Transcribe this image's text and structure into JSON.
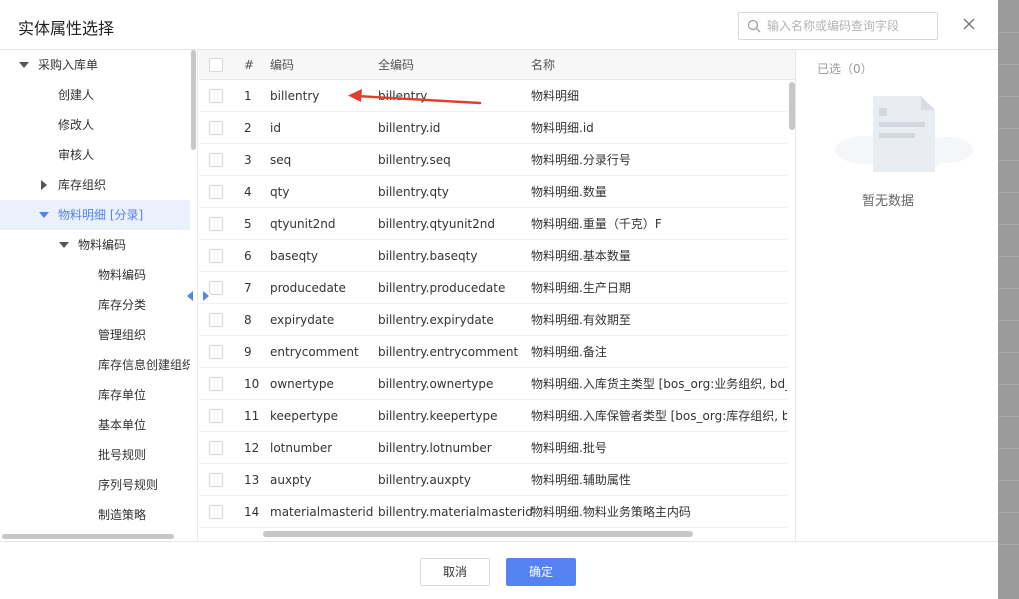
{
  "dialog": {
    "title": "实体属性选择",
    "search_placeholder": "输入名称或编码查询字段"
  },
  "tree": {
    "items": [
      {
        "label": "采购入库单",
        "level": 0,
        "caret": "down",
        "selected": false
      },
      {
        "label": "创建人",
        "level": 1,
        "caret": "none",
        "selected": false
      },
      {
        "label": "修改人",
        "level": 1,
        "caret": "none",
        "selected": false
      },
      {
        "label": "审核人",
        "level": 1,
        "caret": "none",
        "selected": false
      },
      {
        "label": "库存组织",
        "level": 1,
        "caret": "right",
        "selected": false
      },
      {
        "label": "物料明细 [分录]",
        "level": 1,
        "caret": "down",
        "selected": true
      },
      {
        "label": "物料编码",
        "level": 2,
        "caret": "down",
        "selected": false
      },
      {
        "label": "物料编码",
        "level": 3,
        "caret": "none",
        "selected": false
      },
      {
        "label": "库存分类",
        "level": 3,
        "caret": "none",
        "selected": false
      },
      {
        "label": "管理组织",
        "level": 3,
        "caret": "none",
        "selected": false
      },
      {
        "label": "库存信息创建组织",
        "level": 3,
        "caret": "none",
        "selected": false
      },
      {
        "label": "库存单位",
        "level": 3,
        "caret": "none",
        "selected": false
      },
      {
        "label": "基本单位",
        "level": 3,
        "caret": "none",
        "selected": false
      },
      {
        "label": "批号规则",
        "level": 3,
        "caret": "none",
        "selected": false
      },
      {
        "label": "序列号规则",
        "level": 3,
        "caret": "none",
        "selected": false
      },
      {
        "label": "制造策略",
        "level": 3,
        "caret": "none",
        "selected": false
      }
    ]
  },
  "table": {
    "headers": [
      "#",
      "编码",
      "全编码",
      "名称"
    ],
    "rows": [
      {
        "num": "1",
        "code": "billentry",
        "fullcode": "billentry",
        "name": "物料明细"
      },
      {
        "num": "2",
        "code": "id",
        "fullcode": "billentry.id",
        "name": "物料明细.id"
      },
      {
        "num": "3",
        "code": "seq",
        "fullcode": "billentry.seq",
        "name": "物料明细.分录行号"
      },
      {
        "num": "4",
        "code": "qty",
        "fullcode": "billentry.qty",
        "name": "物料明细.数量"
      },
      {
        "num": "5",
        "code": "qtyunit2nd",
        "fullcode": "billentry.qtyunit2nd",
        "name": "物料明细.重量（千克）F"
      },
      {
        "num": "6",
        "code": "baseqty",
        "fullcode": "billentry.baseqty",
        "name": "物料明细.基本数量"
      },
      {
        "num": "7",
        "code": "producedate",
        "fullcode": "billentry.producedate",
        "name": "物料明细.生产日期"
      },
      {
        "num": "8",
        "code": "expirydate",
        "fullcode": "billentry.expirydate",
        "name": "物料明细.有效期至"
      },
      {
        "num": "9",
        "code": "entrycomment",
        "fullcode": "billentry.entrycomment",
        "name": "物料明细.备注"
      },
      {
        "num": "10",
        "code": "ownertype",
        "fullcode": "billentry.ownertype",
        "name": "物料明细.入库货主类型 [bos_org:业务组织, bd_su"
      },
      {
        "num": "11",
        "code": "keepertype",
        "fullcode": "billentry.keepertype",
        "name": "物料明细.入库保管者类型 [bos_org:库存组织, bd_"
      },
      {
        "num": "12",
        "code": "lotnumber",
        "fullcode": "billentry.lotnumber",
        "name": "物料明细.批号"
      },
      {
        "num": "13",
        "code": "auxpty",
        "fullcode": "billentry.auxpty",
        "name": "物料明细.辅助属性"
      },
      {
        "num": "14",
        "code": "materialmasterid",
        "fullcode": "billentry.materialmasterid",
        "name": "物料明细.物料业务策略主内码"
      }
    ]
  },
  "selected_panel": {
    "title": "已选（0）",
    "empty_text": "暂无数据"
  },
  "footer": {
    "cancel_label": "取消",
    "ok_label": "确定"
  },
  "colors": {
    "primary": "#5582f3",
    "selected_bg": "#eaf1fc",
    "annotation_arrow": "#e0402a"
  }
}
